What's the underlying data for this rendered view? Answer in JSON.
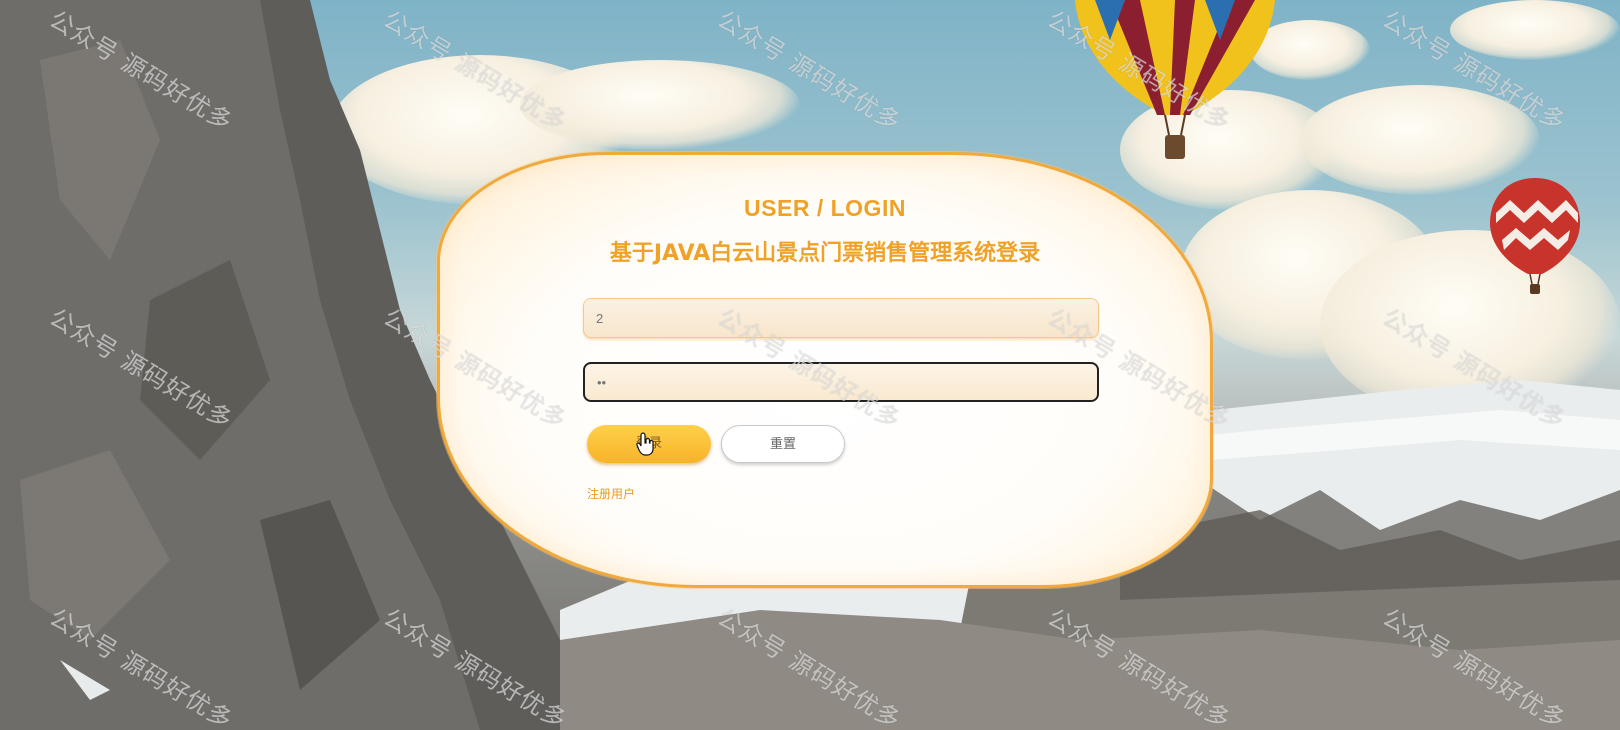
{
  "login": {
    "title_en": "USER / LOGIN",
    "title_cn": "基于JAVA白云山景点门票销售管理系统登录",
    "username_value": "2",
    "password_value": "••",
    "login_button": "登录",
    "reset_button": "重置",
    "register_link": "注册用户"
  },
  "watermark": {
    "text": "公众号 源码好优多"
  },
  "colors": {
    "accent": "#f0a228",
    "card_border": "#f2a93b",
    "login_button": "#ffc83d"
  },
  "icons": {
    "cursor": "hand-pointer-icon",
    "balloon_large": "hot-air-balloon-yellow",
    "balloon_small": "hot-air-balloon-red"
  }
}
